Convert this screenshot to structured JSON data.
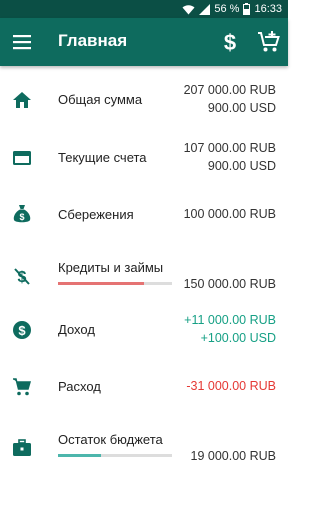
{
  "status_bar": {
    "battery": "56 %",
    "time": "16:33"
  },
  "app_bar": {
    "title": "Главная",
    "menu_icon": "hamburger-menu-icon",
    "currency_icon": "dollar-icon",
    "cart_icon": "add-to-cart-icon"
  },
  "colors": {
    "primary": "#0e6b5e",
    "primary_dark": "#0b4f45",
    "positive": "#16a085",
    "negative": "#e53935",
    "credit_bar": "#e57373",
    "budget_bar": "#4db6ac"
  },
  "rows": [
    {
      "label": "Общая сумма",
      "icon": "home-icon",
      "values": [
        "207 000.00 RUB",
        "900.00 USD"
      ]
    },
    {
      "label": "Текущие счета",
      "icon": "credit-card-icon",
      "values": [
        "107 000.00 RUB",
        "900.00 USD"
      ]
    },
    {
      "label": "Сбережения",
      "icon": "money-bag-icon",
      "values": [
        "100 000.00 RUB"
      ]
    },
    {
      "label": "Кредиты и займы",
      "icon": "money-off-icon",
      "values": [
        "150 000.00 RUB"
      ],
      "progress": 0.75
    },
    {
      "label": "Доход",
      "icon": "dollar-circle-icon",
      "values": [
        "+11 000.00 RUB",
        "+100.00 USD"
      ]
    },
    {
      "label": "Расход",
      "icon": "shopping-cart-icon",
      "values": [
        "-31 000.00 RUB"
      ]
    },
    {
      "label": "Остаток бюджета",
      "icon": "briefcase-icon",
      "values": [
        "19 000.00 RUB"
      ],
      "progress": 0.38
    }
  ]
}
